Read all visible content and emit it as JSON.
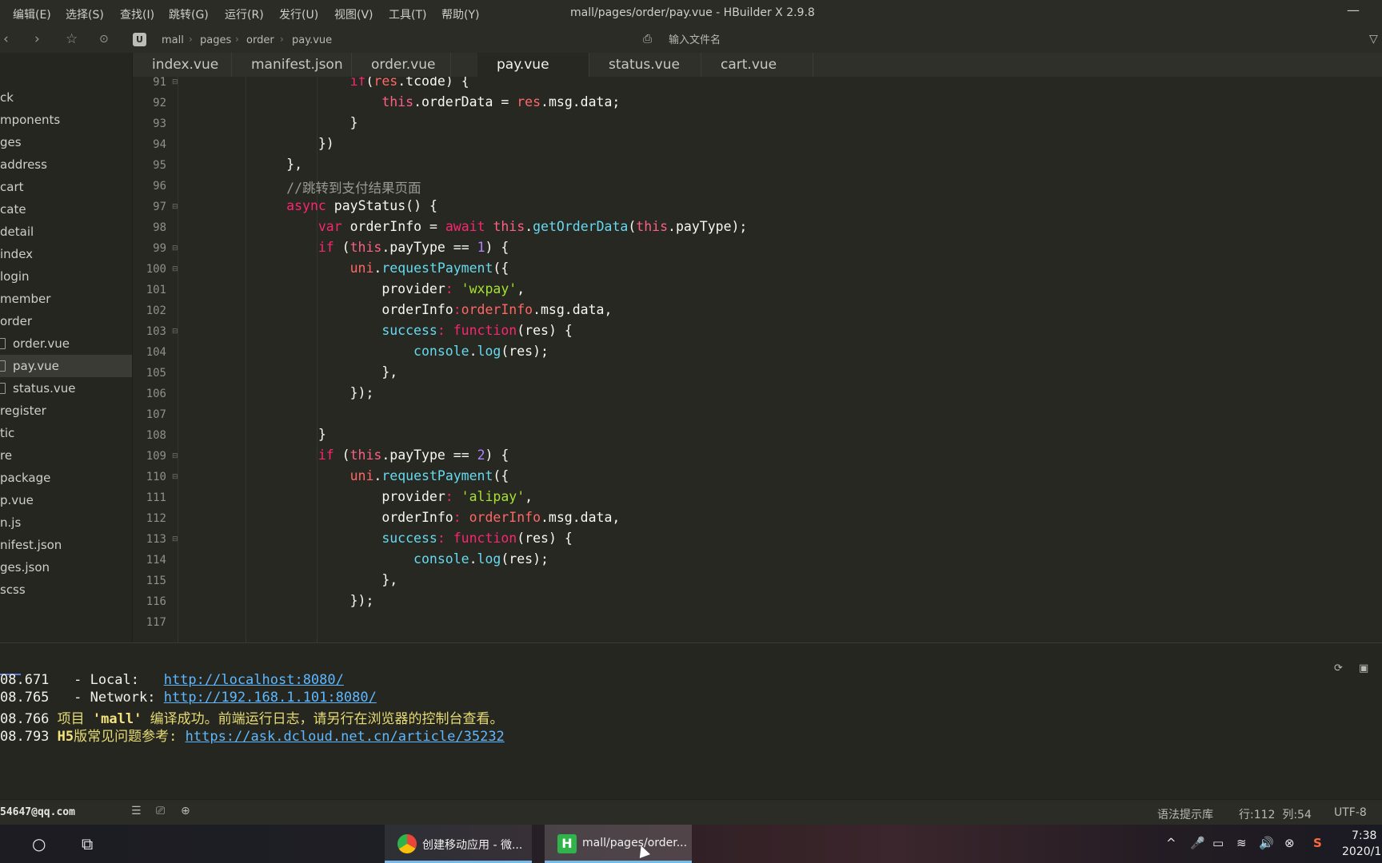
{
  "menu": {
    "items": [
      "编辑(E)",
      "选择(S)",
      "查找(I)",
      "跳转(G)",
      "运行(R)",
      "发行(U)",
      "视图(V)",
      "工具(T)",
      "帮助(Y)"
    ],
    "window_title": "mall/pages/order/pay.vue - HBuilder X 2.9.8",
    "minimize_glyph": "—"
  },
  "nav": {
    "back_glyph": "‹",
    "forward_glyph": "›",
    "star_glyph": "☆",
    "run_glyph": "⊙",
    "app_icon_letter": "U",
    "breadcrumb": [
      "mall",
      "pages",
      "order",
      "pay.vue"
    ],
    "crumb_sep": "›",
    "search_icon_glyph": "⎙",
    "search_placeholder": "输入文件名",
    "filter_glyph": "▽"
  },
  "sidebar": {
    "items": [
      {
        "label": "ck"
      },
      {
        "label": "mponents"
      },
      {
        "label": "ges"
      },
      {
        "label": "address"
      },
      {
        "label": "cart"
      },
      {
        "label": "cate"
      },
      {
        "label": "detail"
      },
      {
        "label": "index"
      },
      {
        "label": "login"
      },
      {
        "label": "member"
      },
      {
        "label": "order"
      },
      {
        "label": "order.vue",
        "file": true
      },
      {
        "label": "pay.vue",
        "file": true,
        "active": true
      },
      {
        "label": "status.vue",
        "file": true
      },
      {
        "label": "register"
      },
      {
        "label": "tic"
      },
      {
        "label": "re"
      },
      {
        "label": "package"
      },
      {
        "label": "p.vue"
      },
      {
        "label": "n.js"
      },
      {
        "label": "nifest.json"
      },
      {
        "label": "ges.json"
      },
      {
        "label": "scss"
      }
    ]
  },
  "tabs": [
    {
      "label": "index.vue"
    },
    {
      "label": "manifest.json"
    },
    {
      "label": "order.vue"
    },
    {
      "label": "pay.vue",
      "active": true
    },
    {
      "label": "status.vue"
    },
    {
      "label": "cart.vue"
    }
  ],
  "editor": {
    "fold_glyph": "⊟",
    "lines": [
      {
        "n": "91",
        "fold": true,
        "indent": 5,
        "parts": [
          [
            "kw",
            "if"
          ],
          [
            "",
            "("
          ],
          [
            "var",
            "res"
          ],
          [
            "",
            ".tcode) {"
          ]
        ]
      },
      {
        "n": "92",
        "fold": false,
        "indent": 6,
        "parts": [
          [
            "th",
            "this"
          ],
          [
            "",
            ".orderData = "
          ],
          [
            "var",
            "res"
          ],
          [
            "",
            ".msg.data;"
          ]
        ]
      },
      {
        "n": "93",
        "fold": false,
        "indent": 5,
        "parts": [
          [
            "",
            "}"
          ]
        ]
      },
      {
        "n": "94",
        "fold": false,
        "indent": 4,
        "parts": [
          [
            "",
            "})"
          ]
        ]
      },
      {
        "n": "95",
        "fold": false,
        "indent": 3,
        "parts": [
          [
            "",
            "},"
          ]
        ]
      },
      {
        "n": "96",
        "fold": false,
        "indent": 3,
        "parts": [
          [
            "cmt",
            "//跳转到支付结果页面"
          ]
        ]
      },
      {
        "n": "97",
        "fold": true,
        "indent": 3,
        "parts": [
          [
            "kw",
            "async"
          ],
          [
            "",
            " payStatus() {"
          ]
        ]
      },
      {
        "n": "98",
        "fold": false,
        "indent": 4,
        "parts": [
          [
            "kw",
            "var"
          ],
          [
            "",
            " orderInfo = "
          ],
          [
            "kw",
            "await"
          ],
          [
            "",
            " "
          ],
          [
            "th",
            "this"
          ],
          [
            "",
            "."
          ],
          [
            "fn",
            "getOrderData"
          ],
          [
            "",
            "("
          ],
          [
            "th",
            "this"
          ],
          [
            "",
            ".payType);"
          ]
        ]
      },
      {
        "n": "99",
        "fold": true,
        "indent": 4,
        "parts": [
          [
            "kw",
            "if"
          ],
          [
            "",
            " ("
          ],
          [
            "th",
            "this"
          ],
          [
            "",
            ".payType == "
          ],
          [
            "num",
            "1"
          ],
          [
            "",
            ") {"
          ]
        ]
      },
      {
        "n": "100",
        "fold": true,
        "indent": 5,
        "parts": [
          [
            "var",
            "uni"
          ],
          [
            "",
            "."
          ],
          [
            "fn",
            "requestPayment"
          ],
          [
            "",
            "({"
          ]
        ]
      },
      {
        "n": "101",
        "fold": false,
        "indent": 6,
        "parts": [
          [
            "",
            "provider"
          ],
          [
            "kw",
            ":"
          ],
          [
            "",
            " "
          ],
          [
            "str",
            "'wxpay'"
          ],
          [
            "",
            ","
          ]
        ]
      },
      {
        "n": "102",
        "fold": false,
        "indent": 6,
        "parts": [
          [
            "",
            "orderInfo"
          ],
          [
            "kw",
            ":"
          ],
          [
            "var",
            "orderInfo"
          ],
          [
            "",
            ".msg.data,"
          ]
        ]
      },
      {
        "n": "103",
        "fold": true,
        "indent": 6,
        "parts": [
          [
            "fn",
            "success"
          ],
          [
            "kw",
            ":"
          ],
          [
            "",
            " "
          ],
          [
            "kw",
            "function"
          ],
          [
            "",
            "(res) {"
          ]
        ]
      },
      {
        "n": "104",
        "fold": false,
        "indent": 7,
        "parts": [
          [
            "fn",
            "console"
          ],
          [
            "",
            "."
          ],
          [
            "fn",
            "log"
          ],
          [
            "",
            "(res);"
          ]
        ]
      },
      {
        "n": "105",
        "fold": false,
        "indent": 6,
        "parts": [
          [
            "",
            "},"
          ]
        ]
      },
      {
        "n": "106",
        "fold": false,
        "indent": 5,
        "parts": [
          [
            "",
            "});"
          ]
        ]
      },
      {
        "n": "107",
        "fold": false,
        "indent": 0,
        "parts": []
      },
      {
        "n": "108",
        "fold": false,
        "indent": 4,
        "parts": [
          [
            "",
            "}"
          ]
        ]
      },
      {
        "n": "109",
        "fold": true,
        "indent": 4,
        "parts": [
          [
            "kw",
            "if"
          ],
          [
            "",
            " ("
          ],
          [
            "th",
            "this"
          ],
          [
            "",
            ".payType == "
          ],
          [
            "num",
            "2"
          ],
          [
            "",
            ") {"
          ]
        ]
      },
      {
        "n": "110",
        "fold": true,
        "indent": 5,
        "parts": [
          [
            "var",
            "uni"
          ],
          [
            "",
            "."
          ],
          [
            "fn",
            "requestPayment"
          ],
          [
            "",
            "({"
          ]
        ]
      },
      {
        "n": "111",
        "fold": false,
        "indent": 6,
        "parts": [
          [
            "",
            "provider"
          ],
          [
            "kw",
            ":"
          ],
          [
            "",
            " "
          ],
          [
            "str",
            "'alipay'"
          ],
          [
            "",
            ","
          ]
        ]
      },
      {
        "n": "112",
        "fold": false,
        "indent": 6,
        "parts": [
          [
            "",
            "orderInfo"
          ],
          [
            "kw",
            ":"
          ],
          [
            "",
            " "
          ],
          [
            "var",
            "orderInfo"
          ],
          [
            "",
            ".msg.data,"
          ]
        ]
      },
      {
        "n": "113",
        "fold": true,
        "indent": 6,
        "parts": [
          [
            "fn",
            "success"
          ],
          [
            "kw",
            ":"
          ],
          [
            "",
            " "
          ],
          [
            "kw",
            "function"
          ],
          [
            "",
            "(res) {"
          ]
        ]
      },
      {
        "n": "114",
        "fold": false,
        "indent": 7,
        "parts": [
          [
            "fn",
            "console"
          ],
          [
            "",
            "."
          ],
          [
            "fn",
            "log"
          ],
          [
            "",
            "(res);"
          ]
        ]
      },
      {
        "n": "115",
        "fold": false,
        "indent": 6,
        "parts": [
          [
            "",
            "},"
          ]
        ]
      },
      {
        "n": "116",
        "fold": false,
        "indent": 5,
        "parts": [
          [
            "",
            "});"
          ]
        ]
      },
      {
        "n": "117",
        "fold": false,
        "indent": 0,
        "parts": []
      }
    ]
  },
  "console": {
    "restart_glyph": "⟳",
    "stop_glyph": "▣",
    "lines": [
      {
        "parts": [
          [
            "",
            "08.671   - Local:   "
          ],
          [
            "link",
            "http://localhost:8080/"
          ]
        ]
      },
      {
        "parts": [
          [
            "",
            "08.765   - Network: "
          ],
          [
            "link",
            "http://192.168.1.101:8080/"
          ]
        ]
      },
      {
        "parts": [
          [
            "",
            "08.766 "
          ],
          [
            "yellow",
            "项目 "
          ],
          [
            "byellow",
            "'mall'"
          ],
          [
            "yellow",
            " 编译成功。前端运行日志，请另行在浏览器的控制台查看。"
          ]
        ]
      },
      {
        "parts": [
          [
            "",
            "08.793 "
          ],
          [
            "byellow",
            "H5"
          ],
          [
            "yellow",
            "版常见问题参考: "
          ],
          [
            "link",
            "https://ask.dcloud.net.cn/article/35232"
          ]
        ]
      }
    ]
  },
  "status": {
    "user": "54647@qq.com",
    "list_glyph": "☰",
    "terminal_glyph": "⎚",
    "globe_glyph": "⊕",
    "syntax_lib": "语法提示库",
    "position": "行:112  列:54",
    "encoding": "UTF-8"
  },
  "taskbar": {
    "start_glyph": "○",
    "taskview_glyph": "⧉",
    "apps": [
      {
        "label": "创建移动应用 - 微...",
        "icon_color": "#e9453a"
      },
      {
        "label": "mall/pages/order...",
        "icon_color": "#2fb34a",
        "icon_letter": "H"
      }
    ],
    "tray_glyphs": [
      "^",
      "🎤",
      "▭",
      "≋",
      "🔊",
      "⊗",
      "S"
    ],
    "clock_time": "7:38",
    "clock_date": "2020/1"
  }
}
